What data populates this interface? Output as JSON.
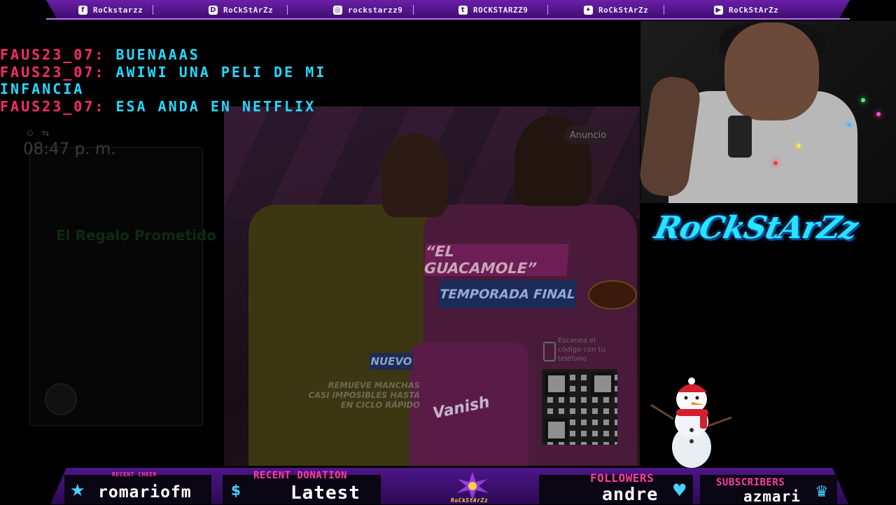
{
  "socials": [
    {
      "icon": "facebook-icon",
      "glyph": "f",
      "label": "RoCkstarzz"
    },
    {
      "icon": "discord-icon",
      "glyph": "D",
      "label": "RoCkStArZz"
    },
    {
      "icon": "instagram-icon",
      "glyph": "◎",
      "label": "rockstarzz9"
    },
    {
      "icon": "twitch-icon",
      "glyph": "t",
      "label": "ROCKSTARZZ9"
    },
    {
      "icon": "twitter-icon",
      "glyph": "✦",
      "label": "RoCkStArZz"
    },
    {
      "icon": "youtube-icon",
      "glyph": "▶",
      "label": "RoCkStArZz"
    }
  ],
  "chat": [
    {
      "user": "FAUS23_07:",
      "text": "BUENAAAS"
    },
    {
      "user": "FAUS23_07:",
      "text": "AWIWI UNA PELI DE MI INFANCIA"
    },
    {
      "user": "FAUS23_07:",
      "text": "ESA ANDA EN NETFLIX"
    }
  ],
  "video": {
    "clock": "08:47 p. m.",
    "ad_label": "Anuncio",
    "show_title": "“EL GUACAMOLE”",
    "season": "TEMPORADA FINAL",
    "nuevo": "NUEVO",
    "claim": "REMUEVE MANCHAS CASI IMPOSIBLES HASTA EN CICLO RÁPIDO",
    "product": "Vanish",
    "scan_text": "Escanea el código con tu teléfono",
    "ghost_title": "El Regalo Prometido"
  },
  "brand": "RoCkStArZz",
  "bottom": {
    "recent_cheer_label": "RECENT CHEER",
    "recent_cheer_value": "romariofm",
    "recent_donation_label": "RECENT DONATION",
    "recent_donation_value": "Latest",
    "followers_label": "FOLLOWERS",
    "followers_value": "andre",
    "subscribers_label": "SUBSCRIBERS",
    "subscribers_value": "azmari",
    "center_logo": "RoCkStArZz"
  },
  "colors": {
    "chat_user": "#ff2a6d",
    "chat_text": "#27d8ff",
    "brand": "#27e4ff",
    "bar": "#4d1687"
  }
}
